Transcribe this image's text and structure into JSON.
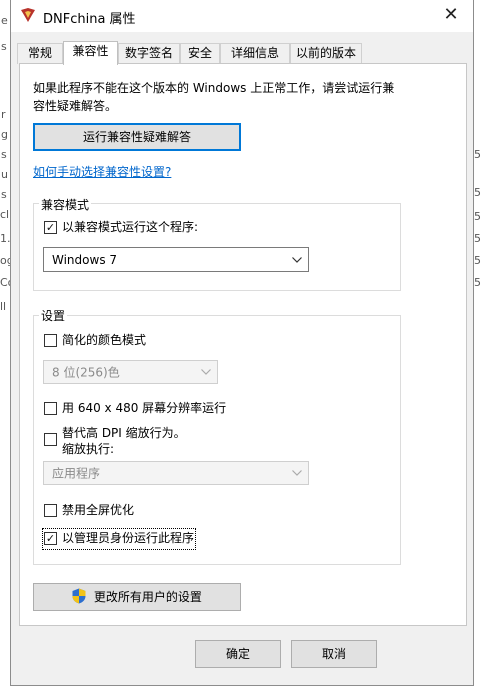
{
  "background": {
    "left_chars": [
      "e",
      "s",
      "r",
      "g",
      "s",
      "u",
      "s",
      "cl",
      "1.",
      "og",
      "Co",
      "ll"
    ],
    "right_chars": [
      "5",
      "5",
      "5",
      "5",
      "5",
      "5"
    ]
  },
  "window": {
    "title": "DNFchina 属性",
    "close_glyph": "✕"
  },
  "tabs": [
    {
      "label": "常规",
      "active": false
    },
    {
      "label": "兼容性",
      "active": true
    },
    {
      "label": "数字签名",
      "active": false
    },
    {
      "label": "安全",
      "active": false
    },
    {
      "label": "详细信息",
      "active": false
    },
    {
      "label": "以前的版本",
      "active": false
    }
  ],
  "compat": {
    "intro_line1": "如果此程序不能在这个版本的 Windows 上正常工作，请尝试运行兼",
    "intro_line2": "容性疑难解答。",
    "troubleshooter_button": "运行兼容性疑难解答",
    "manual_link": "如何手动选择兼容性设置?"
  },
  "compat_mode": {
    "group_label": "兼容模式",
    "checkbox_label": "以兼容模式运行这个程序:",
    "checked": true,
    "selected_os": "Windows 7"
  },
  "settings": {
    "group_label": "设置",
    "reduced_color_label": "简化的颜色模式",
    "reduced_color_checked": false,
    "color_select_value": "8 位(256)色",
    "res_640_label": "用 640 x 480 屏幕分辨率运行",
    "res_640_checked": false,
    "dpi_override_label": "替代高 DPI 缩放行为。",
    "dpi_override_sub": "缩放执行:",
    "dpi_override_checked": false,
    "dpi_select_value": "应用程序",
    "disable_fullscreen_label": "禁用全屏优化",
    "disable_fullscreen_checked": false,
    "run_as_admin_label": "以管理员身份运行此程序",
    "run_as_admin_checked": true
  },
  "all_users_button": "更改所有用户的设置",
  "footer": {
    "ok_label": "确定",
    "cancel_label": "取消"
  },
  "colors": {
    "accent": "#0078d7",
    "link": "#0066cc",
    "dialog_bg": "#f0f0f0",
    "panel_bg": "#ffffff"
  },
  "icons": {
    "title": "app-icon",
    "close": "close-icon",
    "shield": "uac-shield-icon",
    "dropdown": "chevron-down-icon",
    "check": "checkmark-icon"
  }
}
